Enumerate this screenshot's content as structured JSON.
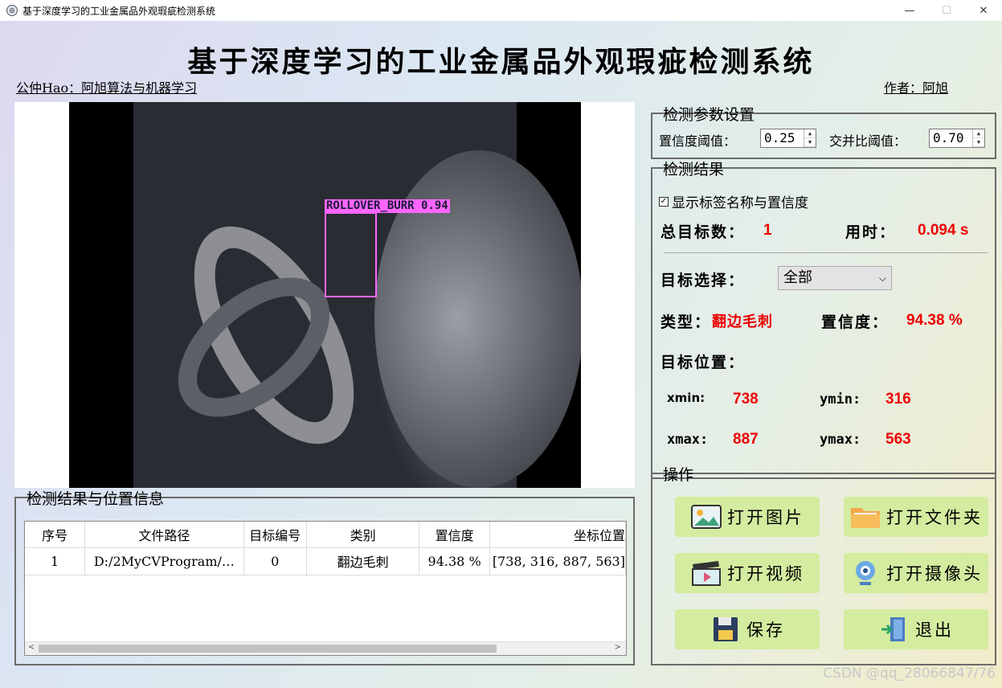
{
  "window": {
    "title": "基于深度学习的工业金属品外观瑕疵检测系统",
    "minimize": "—",
    "maximize": "☐",
    "close": "✕"
  },
  "header": {
    "title": "基于深度学习的工业金属品外观瑕疵检测系统",
    "left_caption": "公仲Hao：阿旭算法与机器学习",
    "right_caption": "作者：阿旭"
  },
  "image": {
    "detection_label": "ROLLOVER_BURR 0.94",
    "box_color": "#ff66ff"
  },
  "params": {
    "title": "检测参数设置",
    "conf_label": "置信度阈值：",
    "conf_value": "0.25",
    "iou_label": "交并比阈值：",
    "iou_value": "0.70"
  },
  "results": {
    "title": "检测结果",
    "show_labels": "显示标签名称与置信度",
    "total_label": "总目标数：",
    "total_value": "1",
    "time_label": "用时：",
    "time_value": "0.094 s",
    "select_label": "目标选择：",
    "select_value": "全部",
    "type_label": "类型：",
    "type_value": "翻边毛刺",
    "conf_label": "置信度：",
    "conf_value": "94.38 %",
    "pos_label": "目标位置：",
    "xmin_label": "xmin:",
    "xmin_value": "738",
    "ymin_label": "ymin:",
    "ymin_value": "316",
    "xmax_label": "xmax:",
    "xmax_value": "887",
    "ymax_label": "ymax:",
    "ymax_value": "563"
  },
  "table": {
    "title": "检测结果与位置信息",
    "headers": [
      "序号",
      "文件路径",
      "目标编号",
      "类别",
      "置信度",
      "坐标位置"
    ],
    "rows": [
      [
        "1",
        "D:/2MyCVProgram/…",
        "0",
        "翻边毛刺",
        "94.38 %",
        "[738, 316, 887, 563]"
      ]
    ]
  },
  "ops": {
    "title": "操作",
    "open_image": "打开图片",
    "open_folder": "打开文件夹",
    "open_video": "打开视频",
    "open_camera": "打开摄像头",
    "save": "保存",
    "exit": "退出"
  },
  "watermark": "CSDN @qq_28066847/76",
  "colors": {
    "accent_red": "#ee0000",
    "button_green": "#d4ec9f"
  }
}
